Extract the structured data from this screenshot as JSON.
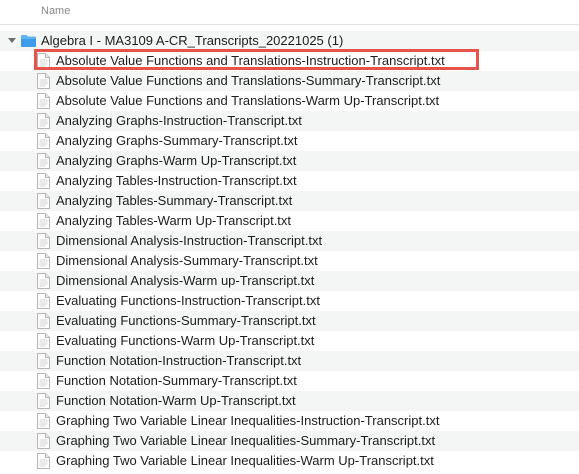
{
  "header": {
    "name_label": "Name"
  },
  "folder": {
    "name": "Algebra I - MA3109 A-CR_Transcripts_20221025 (1)",
    "icon": "folder-icon",
    "disclosure_icon": "disclosure-triangle-icon"
  },
  "file_icon": "text-document-icon",
  "highlight_color": "#e5534b",
  "files": [
    "Absolute Value Functions and Translations-Instruction-Transcript.txt",
    "Absolute Value Functions and Translations-Summary-Transcript.txt",
    "Absolute Value Functions and Translations-Warm Up-Transcript.txt",
    "Analyzing Graphs-Instruction-Transcript.txt",
    "Analyzing Graphs-Summary-Transcript.txt",
    "Analyzing Graphs-Warm Up-Transcript.txt",
    "Analyzing Tables-Instruction-Transcript.txt",
    "Analyzing Tables-Summary-Transcript.txt",
    "Analyzing Tables-Warm Up-Transcript.txt",
    "Dimensional Analysis-Instruction-Transcript.txt",
    "Dimensional Analysis-Summary-Transcript.txt",
    "Dimensional Analysis-Warm up-Transcript.txt",
    "Evaluating Functions-Instruction-Transcript.txt",
    "Evaluating Functions-Summary-Transcript.txt",
    "Evaluating Functions-Warm Up-Transcript.txt",
    "Function Notation-Instruction-Transcript.txt",
    "Function Notation-Summary-Transcript.txt",
    "Function Notation-Warm Up-Transcript.txt",
    "Graphing Two Variable Linear Inequalities-Instruction-Transcript.txt",
    "Graphing Two Variable Linear Inequalities-Summary-Transcript.txt",
    "Graphing Two Variable Linear Inequalities-Warm Up-Transcript.txt"
  ]
}
